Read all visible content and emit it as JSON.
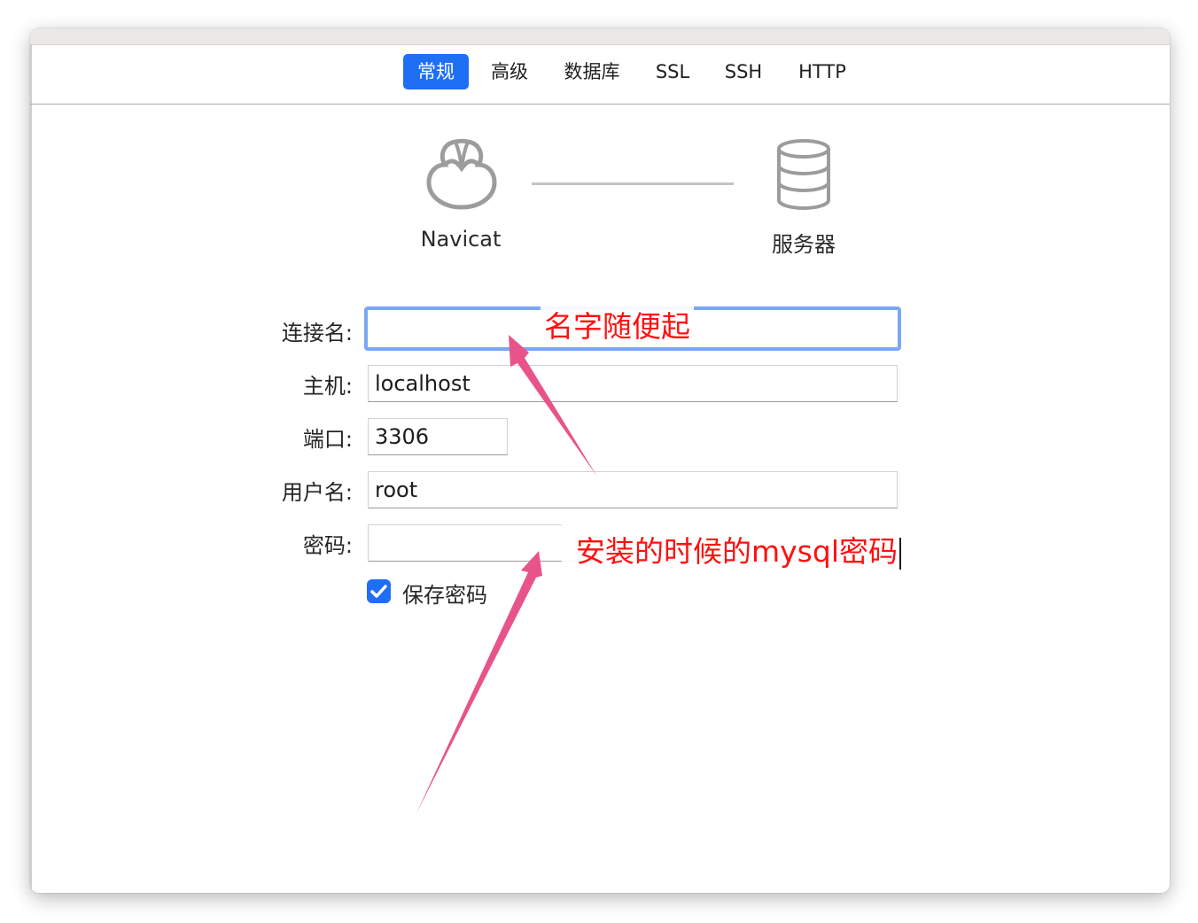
{
  "tabs": [
    {
      "label": "常规",
      "active": true
    },
    {
      "label": "高级",
      "active": false
    },
    {
      "label": "数据库",
      "active": false
    },
    {
      "label": "SSL",
      "active": false
    },
    {
      "label": "SSH",
      "active": false
    },
    {
      "label": "HTTP",
      "active": false
    }
  ],
  "diagram": {
    "client_label": "Navicat",
    "client_icon": "navicat-logo-icon",
    "server_label": "服务器",
    "server_icon": "database-icon"
  },
  "form": {
    "connection_name": {
      "label": "连接名:",
      "value": ""
    },
    "host": {
      "label": "主机:",
      "value": "localhost"
    },
    "port": {
      "label": "端口:",
      "value": "3306"
    },
    "username": {
      "label": "用户名:",
      "value": "root"
    },
    "password": {
      "label": "密码:",
      "value": ""
    },
    "save_password": {
      "label": "保存密码",
      "checked": true
    }
  },
  "annotations": {
    "name_note": "名字随便起",
    "password_note": "安装的时候的mysql密码",
    "color": "#ff1010",
    "arrow_color": "#e8548a"
  },
  "colors": {
    "accent": "#1f6ff5",
    "focus_ring": "#7aa7f4"
  }
}
